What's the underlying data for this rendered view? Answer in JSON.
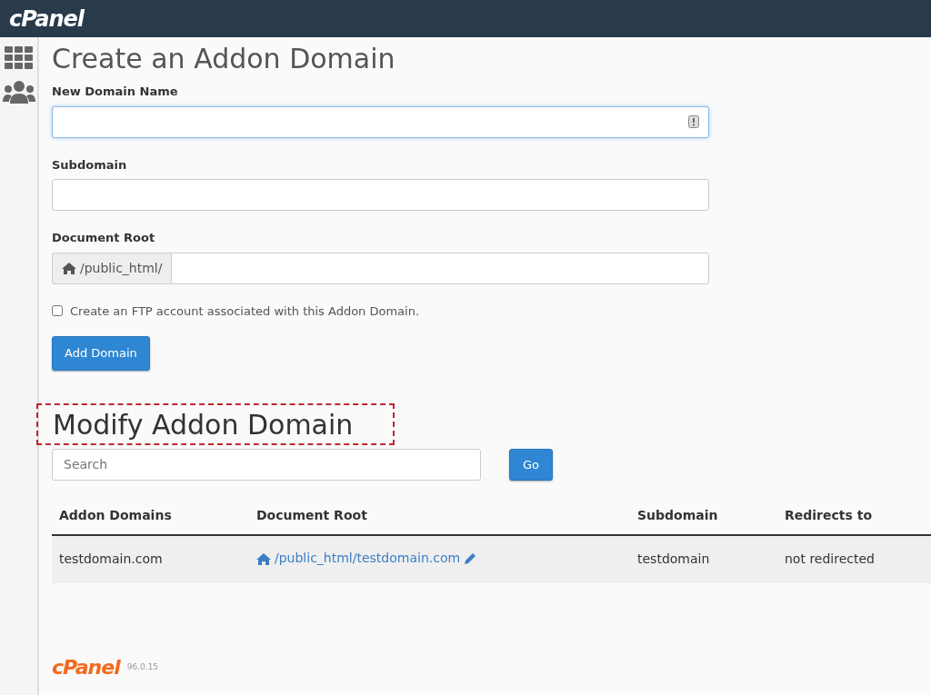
{
  "header": {
    "logo": "cPanel"
  },
  "sidebar": {
    "items": [
      {
        "kind": "grid",
        "selected": false
      },
      {
        "kind": "users",
        "selected": false
      }
    ]
  },
  "create": {
    "title": "Create an Addon Domain",
    "fields": [
      {
        "label": "New Domain Name",
        "focused": true,
        "validation_icon": true
      },
      {
        "label": "Subdomain",
        "focused": false,
        "validation_icon": false
      },
      {
        "label": "Document Root",
        "focused": false,
        "prefix": "/public_html/"
      }
    ],
    "ftp": {
      "label": "Create an FTP account associated with this Addon Domain.",
      "checked": false
    },
    "submit": "Add Domain"
  },
  "modify": {
    "title": "Modify Addon Domain",
    "highlighted": true,
    "search": {
      "placeholder": "Search"
    },
    "go": "Go",
    "table": {
      "columns": [
        "Addon Domains",
        "Document Root",
        "Subdomain",
        "Redirects to"
      ],
      "rows": [
        {
          "domain": "testdomain.com",
          "root": "/public_html/testdomain.com",
          "subdomain": "testdomain",
          "redirect": "not redirected"
        }
      ]
    }
  },
  "footer": {
    "logo": "cPanel",
    "version": "96.0.15"
  }
}
